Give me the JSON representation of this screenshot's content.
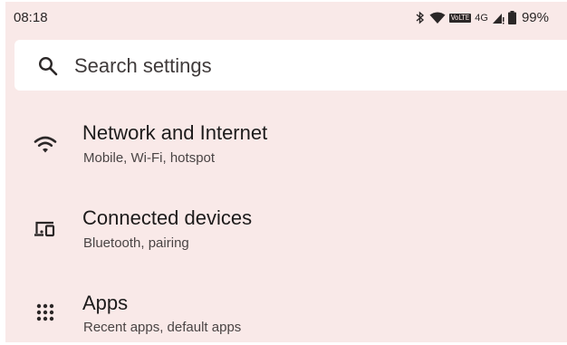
{
  "status_bar": {
    "time": "08:18",
    "volte_label": "VoLTE",
    "network_type": "4G",
    "battery_percent": "99%",
    "icons": [
      "bluetooth-icon",
      "wifi-icon",
      "volte-icon",
      "signal-icon",
      "battery-icon"
    ]
  },
  "search": {
    "placeholder": "Search settings"
  },
  "settings": [
    {
      "title": "Network and Internet",
      "subtitle": "Mobile, Wi-Fi, hotspot",
      "icon": "wifi-icon"
    },
    {
      "title": "Connected devices",
      "subtitle": "Bluetooth, pairing",
      "icon": "connected-devices-icon"
    },
    {
      "title": "Apps",
      "subtitle": "Recent apps, default apps",
      "icon": "apps-grid-icon"
    }
  ],
  "colors": {
    "background": "#f9e9e8",
    "search_bg": "#ffffff",
    "text_primary": "#1d1b1b",
    "text_secondary": "#4a4444"
  }
}
